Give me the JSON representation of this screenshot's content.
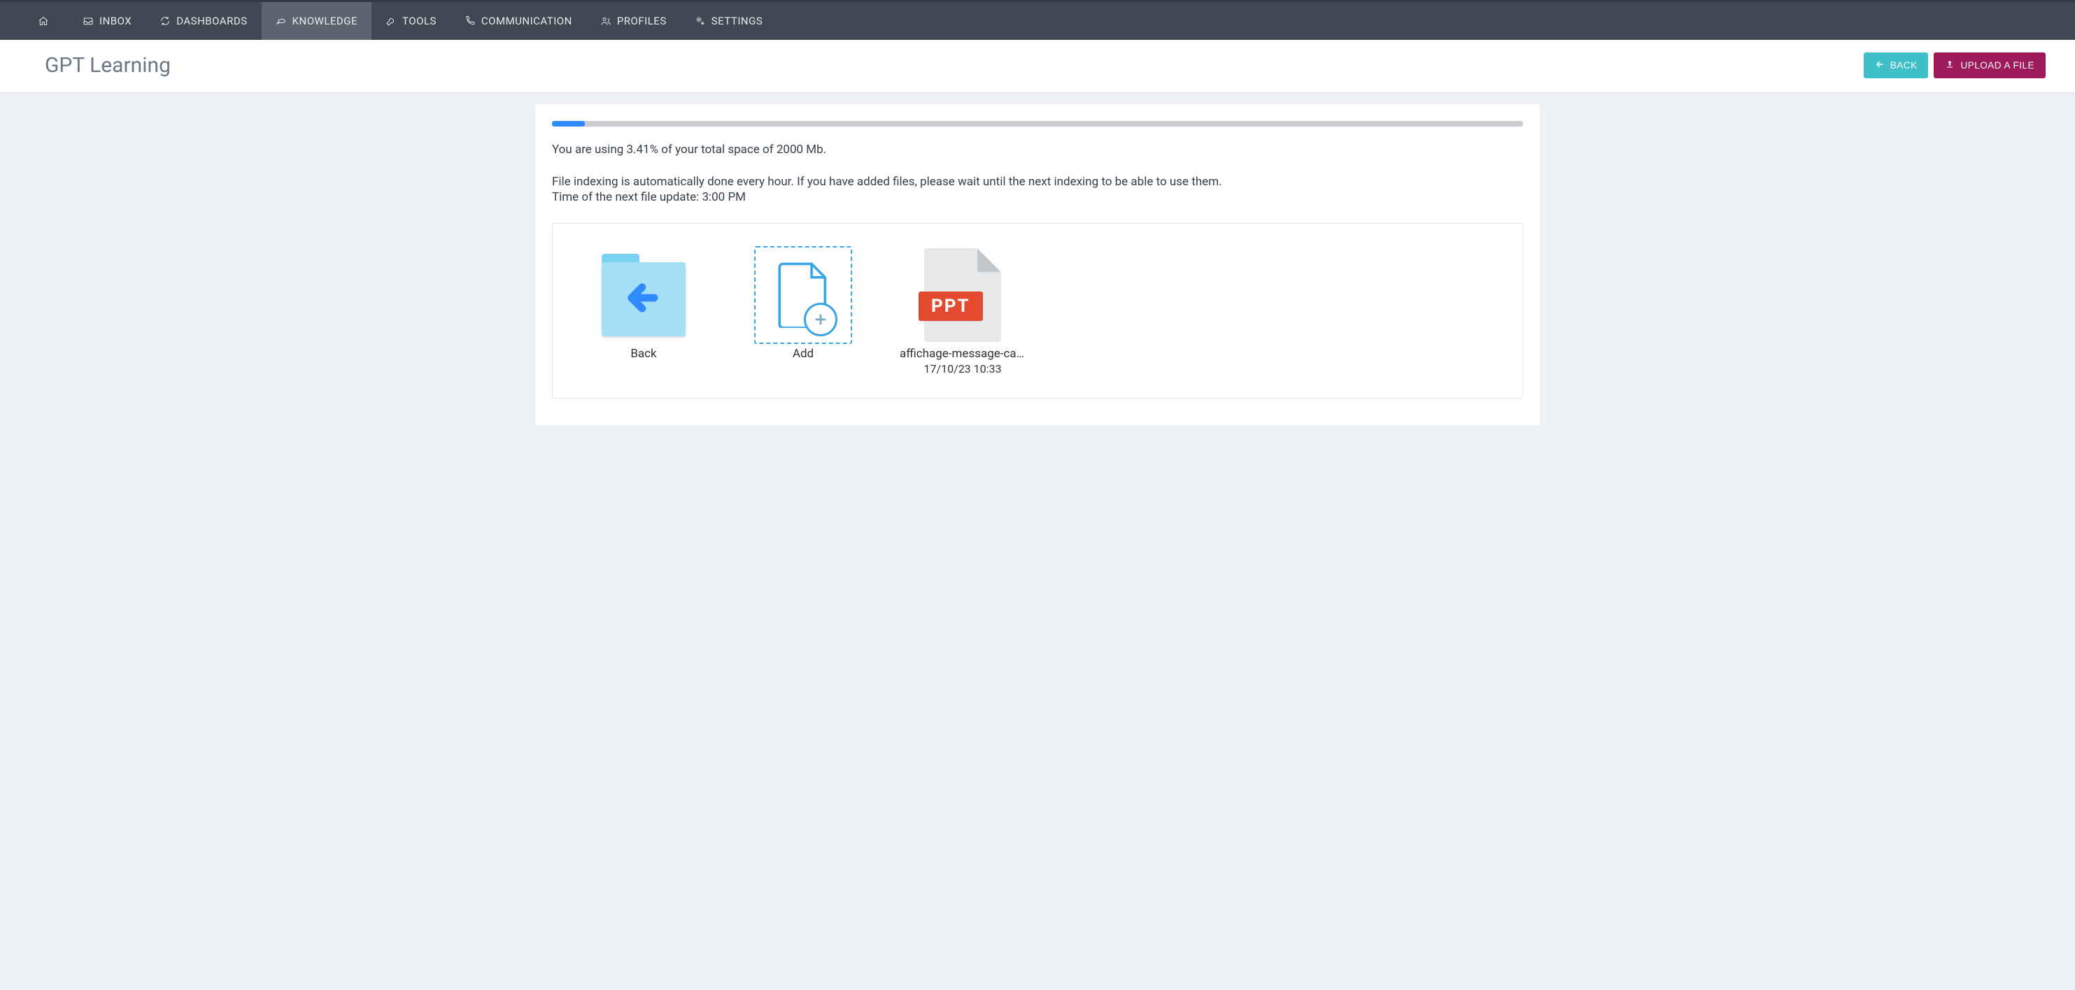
{
  "nav": {
    "items": [
      {
        "label": "INBOX"
      },
      {
        "label": "DASHBOARDS"
      },
      {
        "label": "KNOWLEDGE",
        "active": true
      },
      {
        "label": "TOOLS"
      },
      {
        "label": "COMMUNICATION"
      },
      {
        "label": "PROFILES"
      },
      {
        "label": "SETTINGS"
      }
    ]
  },
  "header": {
    "title": "GPT Learning",
    "back_label": "BACK",
    "upload_label": "UPLOAD A FILE"
  },
  "storage": {
    "percent": 3.41,
    "usage_text": "You are using 3.41% of your total space of 2000 Mb.",
    "indexing_text": "File indexing is automatically done every hour. If you have added files, please wait until the next indexing to be able to use them.",
    "next_update_text": "Time of the next file update: 3:00 PM"
  },
  "tiles": {
    "back": {
      "label": "Back"
    },
    "add": {
      "label": "Add"
    },
    "files": [
      {
        "name": "affichage-message-can...",
        "date": "17/10/23 10:33",
        "badge": "PPT"
      }
    ]
  }
}
